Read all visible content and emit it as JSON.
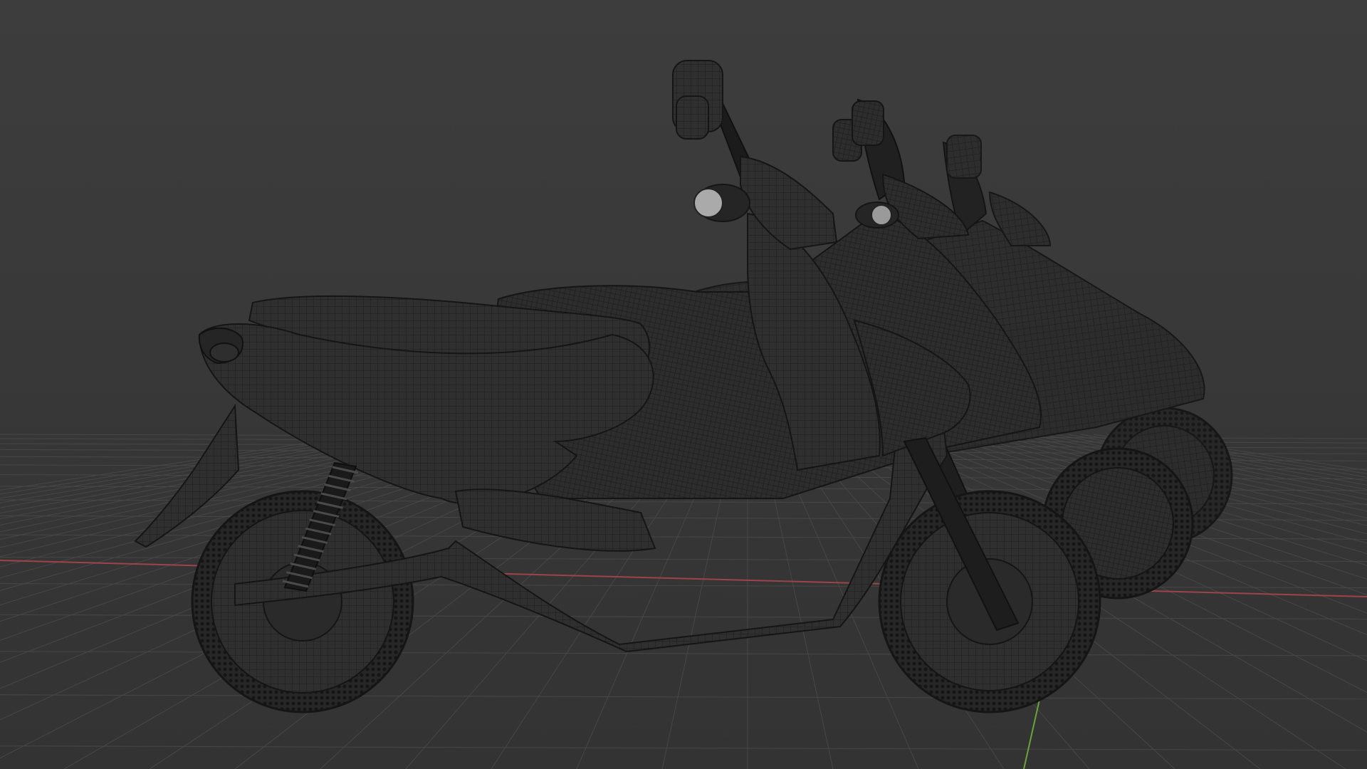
{
  "viewport": {
    "mode": "3d-viewport",
    "shading": "wireframe-overlay",
    "background_color": "#393939",
    "grid_color": "#4a4a4a",
    "axis_x_color": "#b0464e",
    "axis_y_color": "#6aa33a",
    "mesh_fill_color": "#2f2f2f",
    "mesh_wire_color": "#1b1b1b"
  },
  "scene": {
    "objects": [
      {
        "name": "scooter",
        "role": "front"
      },
      {
        "name": "scooter",
        "role": "middle"
      },
      {
        "name": "scooter",
        "role": "back"
      }
    ]
  }
}
